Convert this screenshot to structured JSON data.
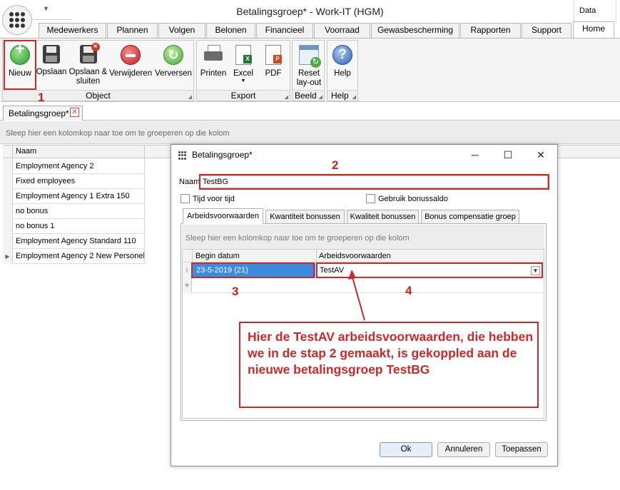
{
  "window": {
    "title": "Betalingsgroep* - Work-IT (HGM)",
    "context_tab": "Data"
  },
  "ribbon": {
    "tabs": [
      {
        "label": "Medewerkers"
      },
      {
        "label": "Plannen"
      },
      {
        "label": "Volgen"
      },
      {
        "label": "Belonen"
      },
      {
        "label": "Financieel"
      },
      {
        "label": "Voorraad"
      },
      {
        "label": "Gewasbescherming"
      },
      {
        "label": "Rapporten"
      },
      {
        "label": "Support"
      },
      {
        "label": "Home",
        "active": true
      }
    ],
    "groups": {
      "object": {
        "label": "Object",
        "buttons": {
          "new": "Nieuw",
          "save": "Opslaan",
          "save_close_1": "Opslaan &",
          "save_close_2": "sluiten",
          "delete": "Verwijderen",
          "refresh": "Verversen"
        }
      },
      "export": {
        "label": "Export",
        "buttons": {
          "print": "Printen",
          "excel": "Excel",
          "pdf": "PDF"
        }
      },
      "view": {
        "label": "Beeld",
        "buttons": {
          "reset_1": "Reset",
          "reset_2": "lay-out"
        }
      },
      "help": {
        "label": "Help",
        "buttons": {
          "help": "Help"
        }
      }
    }
  },
  "document_tab": {
    "label": "Betalingsgroep*"
  },
  "main": {
    "group_panel_hint": "Sleep hier een kolomkop naar toe om te groeperen op die kolom",
    "grid": {
      "column": "Naam",
      "rows": [
        "Employment Agency 2",
        "Fixed employees",
        "Employment Agency 1 Extra 150",
        "no bonus",
        "no bonus 1",
        "Employment Agency Standard 110",
        "Employment Agency 2 New Personel"
      ]
    }
  },
  "dialog": {
    "title": "Betalingsgroep*",
    "name_label": "Naam",
    "name_value": "TestBG",
    "checkbox_time": "Tijd voor tijd",
    "checkbox_bonus": "Gebruik bonussaldo",
    "tabs": [
      {
        "label": "Arbeidsvoorwaarden",
        "active": true
      },
      {
        "label": "Kwantiteit bonussen"
      },
      {
        "label": "Kwaliteit bonussen"
      },
      {
        "label": "Bonus compensatie groep"
      }
    ],
    "group_panel_hint": "Sleep hier een kolomkop naar toe om te groeperen op die kolom",
    "grid": {
      "columns": {
        "start_date": "Begin datum",
        "conditions": "Arbeidsvoorwaarden"
      },
      "row": {
        "start_date": "23-5-2019 (21)",
        "conditions": "TestAV"
      }
    },
    "buttons": {
      "ok": "Ok",
      "cancel": "Annuleren",
      "apply": "Toepassen"
    }
  },
  "annotations": {
    "step_numbers": [
      "1",
      "2",
      "3",
      "4"
    ],
    "note": "Hier de TestAV arbeidsvoorwaarden, die hebben we in de stap 2 gemaakt, is gekoppled aan de nieuwe betalingsgroep TestBG",
    "color": "#cc2929"
  },
  "colors": {
    "selection": "#3b8be0",
    "annotation_red": "#cc2929"
  }
}
